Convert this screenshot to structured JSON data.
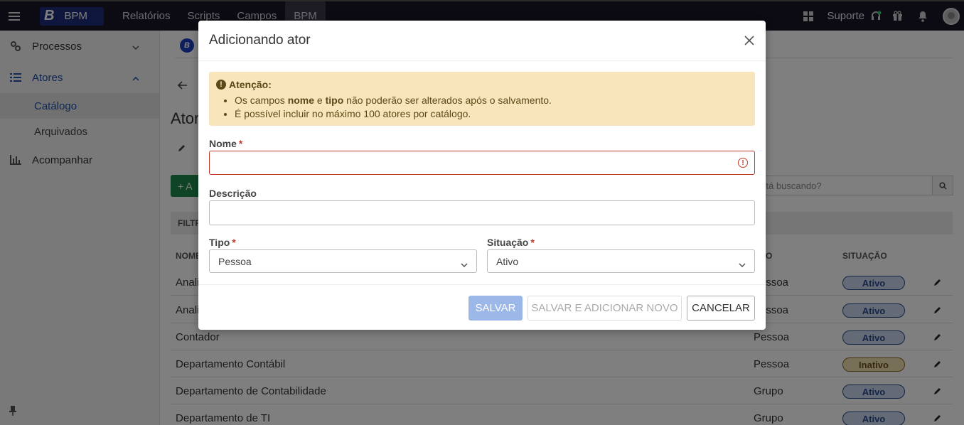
{
  "topbar": {
    "logo_letter": "B",
    "logo_text": "BPM",
    "nav": [
      "Relatórios",
      "Scripts",
      "Campos",
      "BPM"
    ],
    "suporte": "Suporte"
  },
  "sidebar": {
    "items": [
      {
        "label": "Processos"
      },
      {
        "label": "Atores"
      },
      {
        "label": "Catálogo"
      },
      {
        "label": "Arquivados"
      },
      {
        "label": "Acompanhar"
      }
    ]
  },
  "main": {
    "page_title": "Ator",
    "add_label": "+ A",
    "search_placeholder": "stá buscando?",
    "filter_label": "FILTR",
    "columns": {
      "nome": "NOME",
      "tipo": "O",
      "situacao": "SITUAÇÃO"
    },
    "rows": [
      {
        "nome": "Anali",
        "tipo": "essoa",
        "situacao": "Ativo"
      },
      {
        "nome": "Anali",
        "tipo": "essoa",
        "situacao": "Ativo"
      },
      {
        "nome": "Contador",
        "tipo": "Pessoa",
        "situacao": "Ativo"
      },
      {
        "nome": "Departamento Contábil",
        "tipo": "Pessoa",
        "situacao": "Inativo"
      },
      {
        "nome": "Departamento de Contabilidade",
        "tipo": "Grupo",
        "situacao": "Ativo"
      },
      {
        "nome": "Departamento de TI",
        "tipo": "Grupo",
        "situacao": "Ativo"
      }
    ]
  },
  "modal": {
    "title": "Adicionando ator",
    "alert": {
      "title": "Atenção:",
      "line1_a": "Os campos ",
      "line1_b": "nome",
      "line1_c": " e ",
      "line1_d": "tipo",
      "line1_e": " não poderão ser alterados após o salvamento.",
      "line2": "É possível incluir no máximo 100 atores por catálogo."
    },
    "nome_label": "Nome",
    "descricao_label": "Descrição",
    "tipo_label": "Tipo",
    "tipo_value": "Pessoa",
    "situacao_label": "Situação",
    "situacao_value": "Ativo",
    "required_mark": "*",
    "save": "SALVAR",
    "save_new": "SALVAR E ADICIONAR NOVO",
    "cancel": "CANCELAR"
  }
}
